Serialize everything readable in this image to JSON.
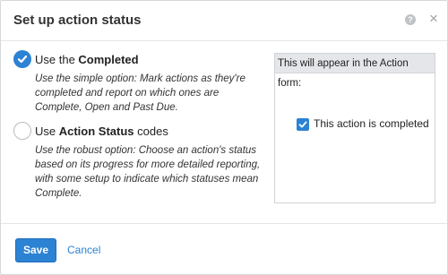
{
  "dialog": {
    "title": "Set up action status",
    "help_icon": "question-circle-icon",
    "close_icon": "close-icon"
  },
  "options": [
    {
      "checked": true,
      "label_prefix": "Use the ",
      "label_bold": "Completed",
      "label_suffix": "",
      "description": "Use the simple option: Mark actions as they're completed and report on which ones are Complete, Open and Past Due."
    },
    {
      "checked": false,
      "label_prefix": "Use ",
      "label_bold": "Action Status",
      "label_suffix": " codes",
      "description": "Use the robust option: Choose an action's status based on its progress for more detailed reporting, with some setup to indicate which statuses mean Complete."
    }
  ],
  "preview": {
    "heading": "This will appear in the Action form:",
    "checkbox_checked": true,
    "checkbox_label": "This action is completed"
  },
  "footer": {
    "save_label": "Save",
    "cancel_label": "Cancel"
  },
  "colors": {
    "accent": "#2c82d3"
  }
}
